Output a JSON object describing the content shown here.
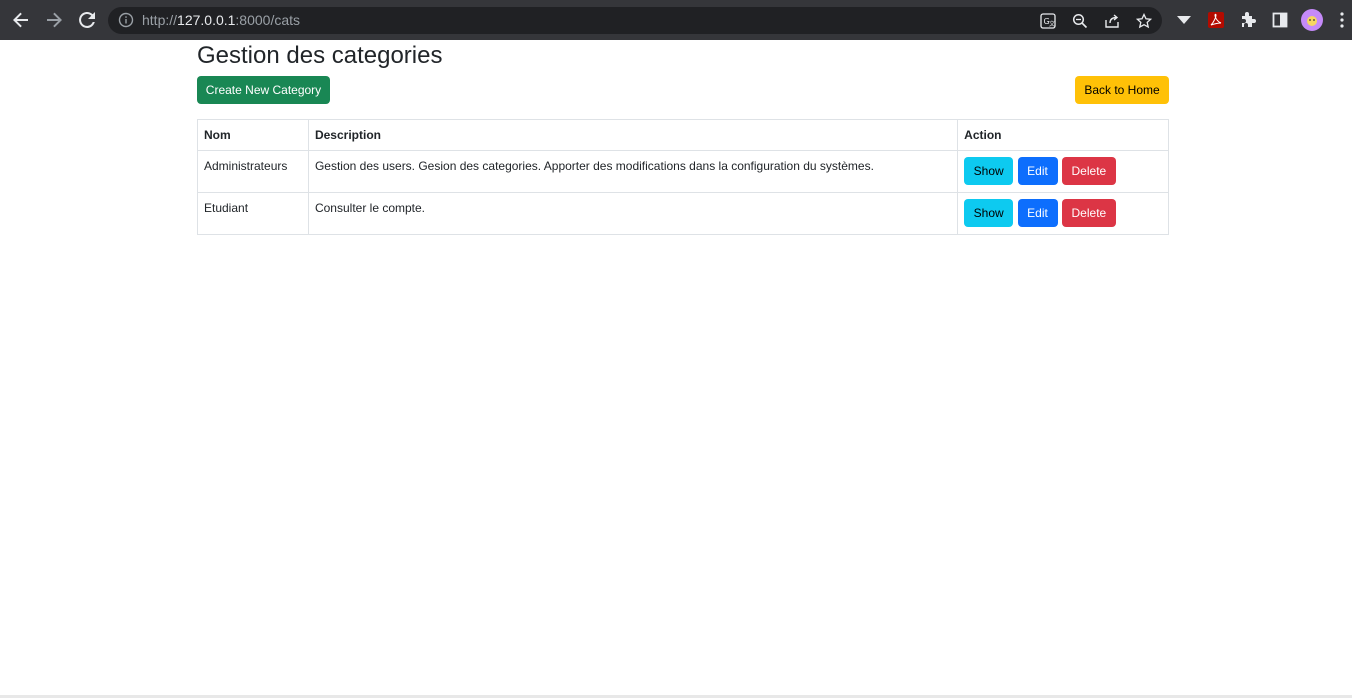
{
  "browser": {
    "url_scheme": "http://",
    "url_host": "127.0.0.1",
    "url_path": ":8000/cats",
    "icons": [
      "back-arrow-icon",
      "forward-arrow-icon",
      "reload-icon",
      "info-icon",
      "translate-icon",
      "zoom-icon",
      "share-icon",
      "star-icon",
      "dropdown-icon",
      "pdf-icon",
      "puzzle-icon",
      "sidebar-icon",
      "avatar",
      "more-icon"
    ]
  },
  "page": {
    "title": "Gestion des categories",
    "create_button": "Create New Category",
    "home_button": "Back to Home"
  },
  "table": {
    "headers": [
      "Nom",
      "Description",
      "Action"
    ],
    "rows": [
      {
        "nom": "Administrateurs",
        "description": "Gestion des users. Gesion des categories. Apporter des modifications dans la configuration du systèmes.",
        "show": "Show",
        "edit": "Edit",
        "delete": "Delete"
      },
      {
        "nom": "Etudiant",
        "description": "Consulter le compte.",
        "show": "Show",
        "edit": "Edit",
        "delete": "Delete"
      }
    ]
  },
  "colors": {
    "success": "#198754",
    "warning": "#ffc107",
    "info": "#0dcaf0",
    "primary": "#0d6efd",
    "danger": "#dc3545"
  }
}
